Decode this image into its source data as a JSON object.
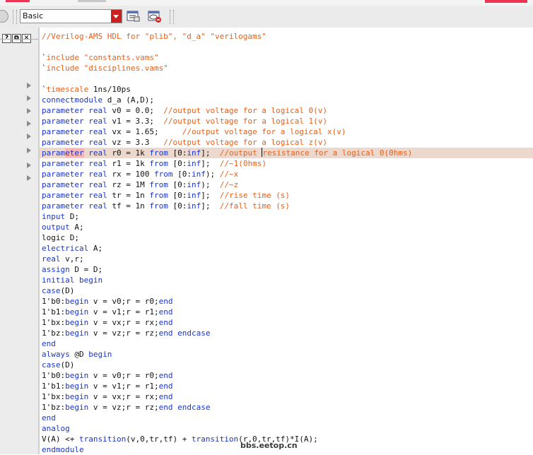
{
  "toolbar": {
    "mode_select": "Basic",
    "icons": [
      "list-window-icon",
      "hide-window-icon"
    ]
  },
  "left_panel": {
    "buttons": [
      "?",
      "⧉",
      "✕"
    ],
    "fold_arrows": 8
  },
  "watermark": "bbs.eetop.cn",
  "editor": {
    "highlight_line": 12,
    "lines": [
      [
        [
          "c",
          "//Verilog-AMS HDL for \"plib\", \"d_a\" \"verilogams\""
        ]
      ],
      [],
      [
        [
          "d",
          "`"
        ],
        [
          "c",
          "include"
        ],
        [
          "d",
          " "
        ],
        [
          "c",
          "\"constants.vams\""
        ]
      ],
      [
        [
          "d",
          "`"
        ],
        [
          "c",
          "include"
        ],
        [
          "d",
          " "
        ],
        [
          "c",
          "\"disciplines.vams\""
        ]
      ],
      [],
      [
        [
          "d",
          "`"
        ],
        [
          "c",
          "timescale"
        ],
        [
          "d",
          " 1ns/10ps"
        ]
      ],
      [
        [
          "k",
          "connectmodule"
        ],
        [
          "d",
          " d_a (A,D);"
        ]
      ],
      [
        [
          "k",
          "parameter"
        ],
        [
          "d",
          " "
        ],
        [
          "k",
          "real"
        ],
        [
          "d",
          " v0 = 0.0;  "
        ],
        [
          "c",
          "//output voltage for a logical 0(v)"
        ]
      ],
      [
        [
          "k",
          "parameter"
        ],
        [
          "d",
          " "
        ],
        [
          "k",
          "real"
        ],
        [
          "d",
          " v1 = 3.3;  "
        ],
        [
          "c",
          "//output voltage for a logical 1(v)"
        ]
      ],
      [
        [
          "k",
          "parameter"
        ],
        [
          "d",
          " "
        ],
        [
          "k",
          "real"
        ],
        [
          "d",
          " vx = 1.65;     "
        ],
        [
          "c",
          "//output voltage for a logical x(v)"
        ]
      ],
      [
        [
          "k",
          "parameter"
        ],
        [
          "d",
          " "
        ],
        [
          "k",
          "real"
        ],
        [
          "d",
          " vz = 3.3   "
        ],
        [
          "c",
          "//output voltage for a logical z(v)"
        ]
      ],
      [
        [
          "k",
          "param"
        ],
        [
          "ktf",
          "eter"
        ],
        [
          "k",
          " real"
        ],
        [
          "d",
          " r0 = 1k "
        ],
        [
          "k",
          "from"
        ],
        [
          "d",
          " [0:"
        ],
        [
          "k",
          "inf"
        ],
        [
          "d",
          "];  "
        ],
        [
          "c",
          "//output "
        ],
        [
          "caret",
          ""
        ],
        [
          "c",
          "resistance for a logical 0(0hms)"
        ]
      ],
      [
        [
          "k",
          "parameter"
        ],
        [
          "d",
          " "
        ],
        [
          "k",
          "real"
        ],
        [
          "d",
          " r1 = 1k "
        ],
        [
          "k",
          "from"
        ],
        [
          "d",
          " [0:"
        ],
        [
          "k",
          "inf"
        ],
        [
          "d",
          "];  "
        ],
        [
          "c",
          "//~1(0hms)"
        ]
      ],
      [
        [
          "k",
          "parameter"
        ],
        [
          "d",
          " "
        ],
        [
          "k",
          "real"
        ],
        [
          "d",
          " rx = 100 "
        ],
        [
          "k",
          "from"
        ],
        [
          "d",
          " [0:"
        ],
        [
          "k",
          "inf"
        ],
        [
          "d",
          "); "
        ],
        [
          "c",
          "//~x"
        ]
      ],
      [
        [
          "k",
          "parameter"
        ],
        [
          "d",
          " "
        ],
        [
          "k",
          "real"
        ],
        [
          "d",
          " rz = 1M "
        ],
        [
          "k",
          "from"
        ],
        [
          "d",
          " [0:"
        ],
        [
          "k",
          "inf"
        ],
        [
          "d",
          ");  "
        ],
        [
          "c",
          "//~z"
        ]
      ],
      [
        [
          "k",
          "parameter"
        ],
        [
          "d",
          " "
        ],
        [
          "k",
          "real"
        ],
        [
          "d",
          " tr = 1n "
        ],
        [
          "k",
          "from"
        ],
        [
          "d",
          " [0:"
        ],
        [
          "k",
          "inf"
        ],
        [
          "d",
          "];  "
        ],
        [
          "c",
          "//rise time (s)"
        ]
      ],
      [
        [
          "k",
          "parameter"
        ],
        [
          "d",
          " "
        ],
        [
          "k",
          "real"
        ],
        [
          "d",
          " tf = 1n "
        ],
        [
          "k",
          "from"
        ],
        [
          "d",
          " [0:"
        ],
        [
          "k",
          "inf"
        ],
        [
          "d",
          "];  "
        ],
        [
          "c",
          "//fall time (s)"
        ]
      ],
      [
        [
          "k",
          "input"
        ],
        [
          "d",
          " D;"
        ]
      ],
      [
        [
          "k",
          "output"
        ],
        [
          "d",
          " A;"
        ]
      ],
      [
        [
          "d",
          "logic D;"
        ]
      ],
      [
        [
          "k",
          "electrical"
        ],
        [
          "d",
          " A;"
        ]
      ],
      [
        [
          "k",
          "real"
        ],
        [
          "d",
          " v,r;"
        ]
      ],
      [
        [
          "k",
          "assign"
        ],
        [
          "d",
          " D = D;"
        ]
      ],
      [
        [
          "k",
          "initial"
        ],
        [
          "d",
          " "
        ],
        [
          "k",
          "begin"
        ]
      ],
      [
        [
          "k",
          "case"
        ],
        [
          "d",
          "(D)"
        ]
      ],
      [
        [
          "d",
          "1'b0:"
        ],
        [
          "k",
          "begin"
        ],
        [
          "d",
          " v = v0;r = r0;"
        ],
        [
          "k",
          "end"
        ]
      ],
      [
        [
          "d",
          "1'b1:"
        ],
        [
          "k",
          "begin"
        ],
        [
          "d",
          " v = v1;r = r1;"
        ],
        [
          "k",
          "end"
        ]
      ],
      [
        [
          "d",
          "1'bx:"
        ],
        [
          "k",
          "begin"
        ],
        [
          "d",
          " v = vx;r = rx;"
        ],
        [
          "k",
          "end"
        ]
      ],
      [
        [
          "d",
          "1'bz:"
        ],
        [
          "k",
          "begin"
        ],
        [
          "d",
          " v = vz;r = rz;"
        ],
        [
          "k",
          "end"
        ],
        [
          "d",
          " "
        ],
        [
          "k",
          "endcase"
        ]
      ],
      [
        [
          "k",
          "end"
        ]
      ],
      [
        [
          "k",
          "always"
        ],
        [
          "d",
          " @D "
        ],
        [
          "k",
          "begin"
        ]
      ],
      [
        [
          "k",
          "case"
        ],
        [
          "d",
          "(D)"
        ]
      ],
      [
        [
          "d",
          "1'b0:"
        ],
        [
          "k",
          "begin"
        ],
        [
          "d",
          " v = v0;r = r0;"
        ],
        [
          "k",
          "end"
        ]
      ],
      [
        [
          "d",
          "1'b1:"
        ],
        [
          "k",
          "begin"
        ],
        [
          "d",
          " v = v1;r = r1;"
        ],
        [
          "k",
          "end"
        ]
      ],
      [
        [
          "d",
          "1'bx:"
        ],
        [
          "k",
          "begin"
        ],
        [
          "d",
          " v = vx;r = rx;"
        ],
        [
          "k",
          "end"
        ]
      ],
      [
        [
          "d",
          "1'bz:"
        ],
        [
          "k",
          "begin"
        ],
        [
          "d",
          " v = vz;r = rz;"
        ],
        [
          "k",
          "end"
        ],
        [
          "d",
          " "
        ],
        [
          "k",
          "endcase"
        ]
      ],
      [
        [
          "k",
          "end"
        ]
      ],
      [
        [
          "k",
          "analog"
        ]
      ],
      [
        [
          "d",
          "V(A) <+ "
        ],
        [
          "k",
          "transition"
        ],
        [
          "d",
          "(v,0,tr,tf) + "
        ],
        [
          "k",
          "transition"
        ],
        [
          "d",
          "(r,0,tr,tf)*I(A);"
        ]
      ],
      [
        [
          "k",
          "endmodule"
        ]
      ]
    ]
  }
}
